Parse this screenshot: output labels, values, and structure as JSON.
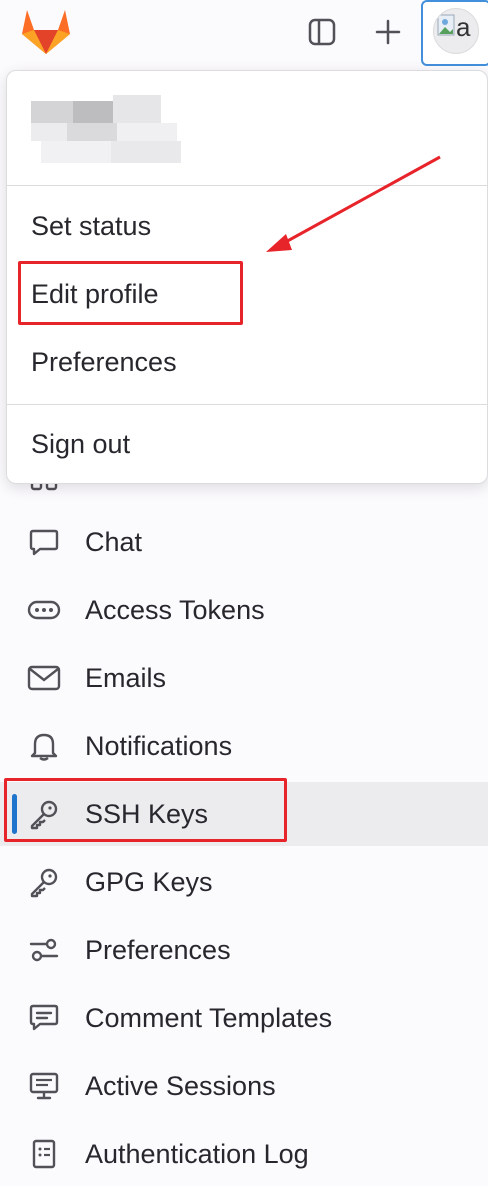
{
  "topbar": {
    "logo_icon": "gitlab-tanuki-icon",
    "sidebar_toggle_icon": "sidebar-icon",
    "create_icon": "plus-icon",
    "avatar_letter": "a"
  },
  "dropdown": {
    "items": {
      "set_status": "Set status",
      "edit_profile": "Edit profile",
      "preferences": "Preferences",
      "sign_out": "Sign out"
    }
  },
  "nav": {
    "items": [
      {
        "label": "Chat",
        "icon": "chat-icon"
      },
      {
        "label": "Access Tokens",
        "icon": "token-icon"
      },
      {
        "label": "Emails",
        "icon": "mail-icon"
      },
      {
        "label": "Notifications",
        "icon": "bell-icon"
      },
      {
        "label": "SSH Keys",
        "icon": "key-icon",
        "active": true
      },
      {
        "label": "GPG Keys",
        "icon": "key-icon"
      },
      {
        "label": "Preferences",
        "icon": "preferences-icon"
      },
      {
        "label": "Comment Templates",
        "icon": "comment-icon"
      },
      {
        "label": "Active Sessions",
        "icon": "monitor-icon"
      },
      {
        "label": "Authentication Log",
        "icon": "log-icon"
      }
    ]
  },
  "colors": {
    "accent": "#1f75cb",
    "annotation": "#e8242b",
    "gitlab_orange": "#fc6d26"
  }
}
